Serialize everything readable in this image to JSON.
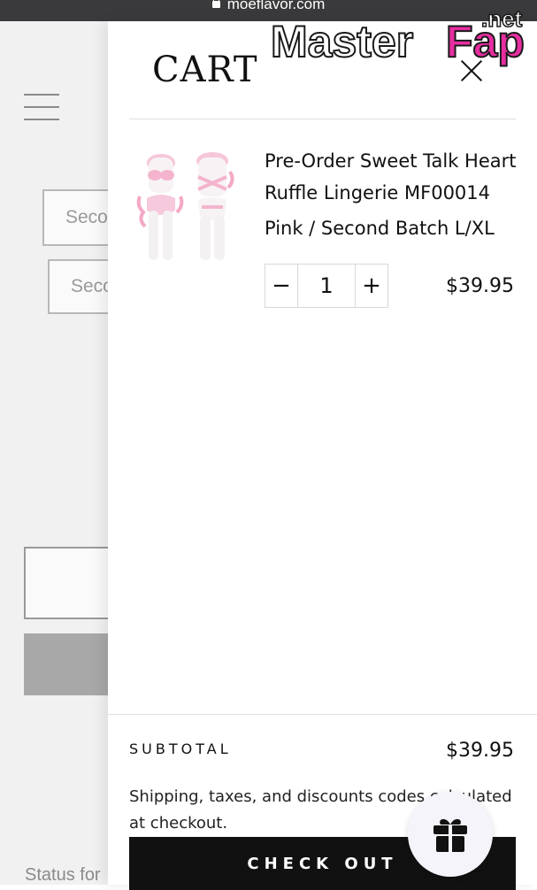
{
  "browser": {
    "url": "moeflavor.com"
  },
  "background_page": {
    "select_1": "Seco",
    "select_2": "Seco",
    "status_text": "Status for"
  },
  "cart": {
    "title": "CART",
    "item": {
      "name": "Pre-Order Sweet Talk Heart Ruffle Lingerie MF00014",
      "variant": "Pink / Second Batch L/XL",
      "quantity": "1",
      "minus": "−",
      "plus": "+",
      "price": "$39.95"
    },
    "subtotal_label": "SUBTOTAL",
    "subtotal_value": "$39.95",
    "shipping_note": "Shipping, taxes, and discounts codes calculated at checkout.",
    "checkout_label": "CHECK OUT"
  },
  "watermark": {
    "brand": "MasterFap",
    "tld": ".net"
  },
  "colors": {
    "accent": "#111111",
    "background": "#f1f1f1",
    "watermark_pink": "#e62ea0"
  },
  "icons": [
    "lock-icon",
    "hamburger-icon",
    "close-icon",
    "minus-icon",
    "plus-icon",
    "gift-icon"
  ]
}
